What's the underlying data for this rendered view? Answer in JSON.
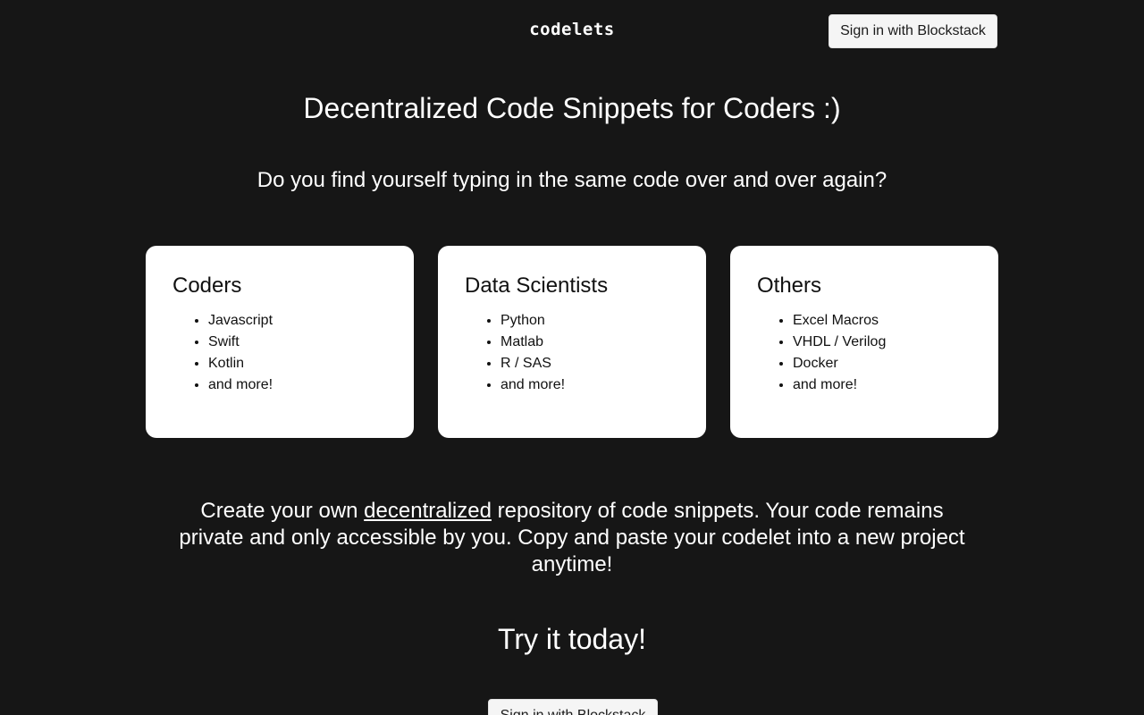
{
  "header": {
    "logo": "codelets",
    "signin_label": "Sign in with Blockstack"
  },
  "hero": {
    "title": "Decentralized Code Snippets for Coders :)",
    "subtitle": "Do you find yourself typing in the same code over and over again?"
  },
  "cards": [
    {
      "title": "Coders",
      "items": [
        "Javascript",
        "Swift",
        "Kotlin",
        "and more!"
      ]
    },
    {
      "title": "Data Scientists",
      "items": [
        "Python",
        "Matlab",
        "R / SAS",
        "and more!"
      ]
    },
    {
      "title": "Others",
      "items": [
        "Excel Macros",
        "VHDL / Verilog",
        "Docker",
        "and more!"
      ]
    }
  ],
  "description": {
    "before_link": "Create your own ",
    "link_text": "decentralized",
    "after_link": " repository of code snippets. Your code remains private and only accessible by you. Copy and paste your codelet into a new project anytime!"
  },
  "cta": {
    "title": "Try it today!",
    "signin_label": "Sign in with Blockstack"
  },
  "colors": {
    "background": "#161616",
    "card_background": "#ffffff",
    "button_background": "#f5f5f5"
  }
}
